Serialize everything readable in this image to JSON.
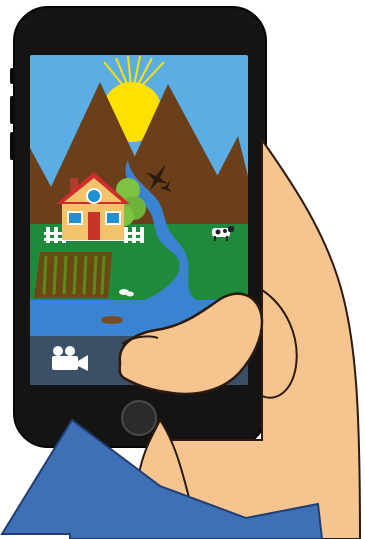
{
  "scene": {
    "colors": {
      "phone_body": "#141414",
      "sky": "#5aaee3",
      "sun": "#ffe100",
      "mountain": "#6b3f1a",
      "grass": "#1f8a3c",
      "river": "#3a83d0",
      "skin": "#f6c48e",
      "camera_bar": "#3b4f66",
      "arrow": "#3f6fb5"
    },
    "icons": {
      "video_mode": "video-camera-icon",
      "shutter": "shutter-button-icon",
      "home": "home-button-icon"
    }
  }
}
